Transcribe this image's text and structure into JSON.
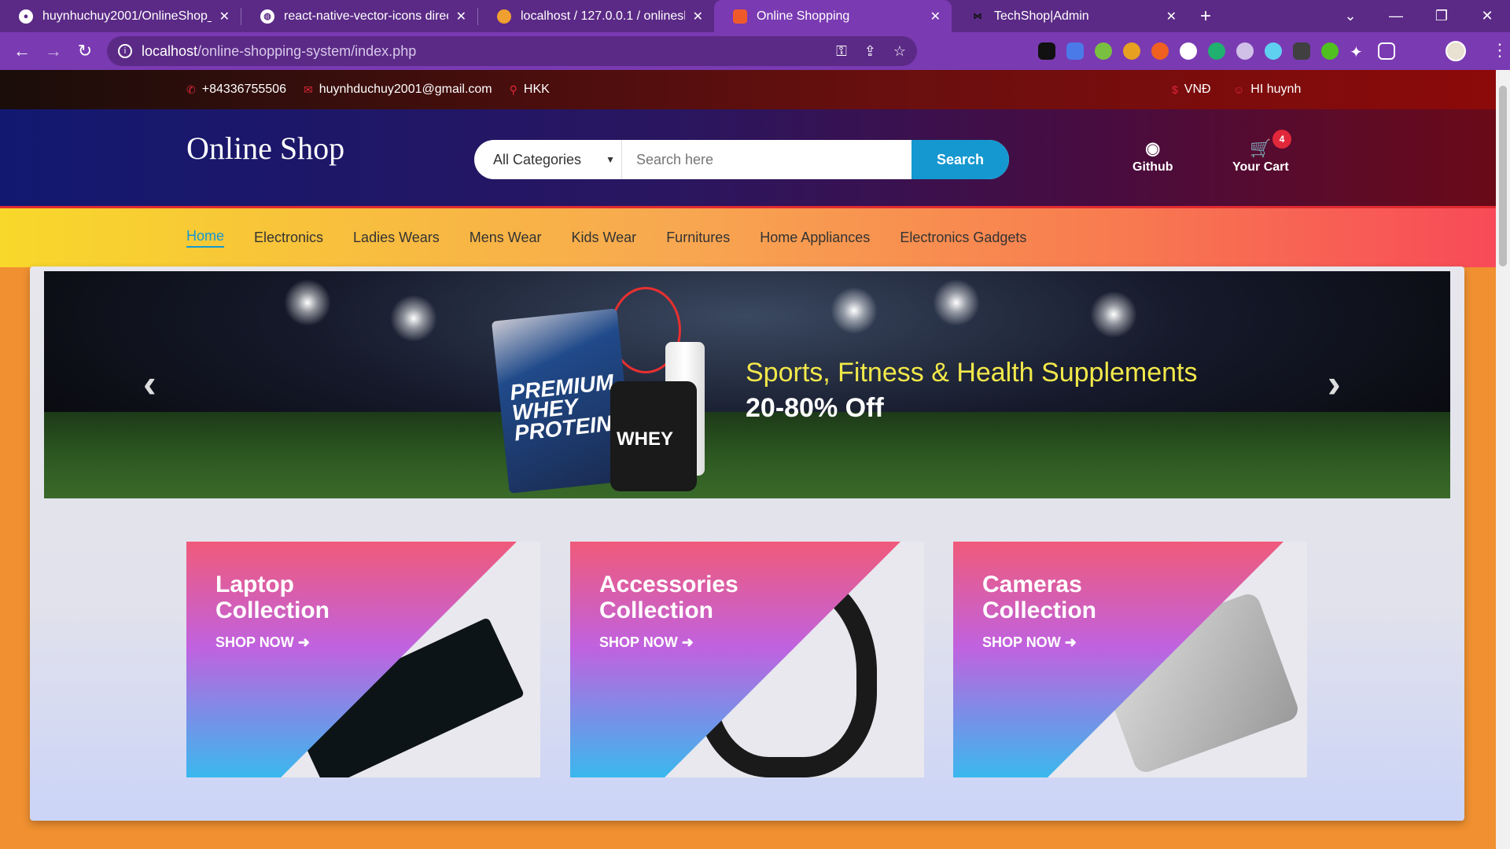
{
  "browser": {
    "tabs": [
      {
        "label": "huynhuchuy2001/OnlineShop_P..."
      },
      {
        "label": "react-native-vector-icons directo..."
      },
      {
        "label": "localhost / 127.0.0.1 / onlineshop..."
      },
      {
        "label": "Online Shopping"
      },
      {
        "label": "TechShop|Admin"
      }
    ],
    "url_host": "localhost",
    "url_path": "/online-shopping-system/index.php"
  },
  "topbar": {
    "phone": "+84336755506",
    "email": "huynhduchuy2001@gmail.com",
    "location": "HKK",
    "currency": "VNĐ",
    "user": "HI huynh"
  },
  "header": {
    "logo": "Online Shop",
    "category": "All Categories",
    "search_placeholder": "Search here",
    "search_button": "Search",
    "github_label": "Github",
    "cart_label": "Your Cart",
    "cart_count": "4"
  },
  "menu": [
    "Home",
    "Electronics",
    "Ladies Wears",
    "Mens Wear",
    "Kids Wear",
    "Furnitures",
    "Home Appliances",
    "Electronics Gadgets"
  ],
  "banner": {
    "title": "Sports, Fitness & Health Supplements",
    "subtitle": "20-80% Off",
    "bag_text": "PREMIUM WHEY PROTEIN",
    "jar_text": "WHEY"
  },
  "promos": [
    {
      "line1": "Laptop",
      "line2": "Collection",
      "cta": "SHOP NOW"
    },
    {
      "line1": "Accessories",
      "line2": "Collection",
      "cta": "SHOP NOW"
    },
    {
      "line1": "Cameras",
      "line2": "Collection",
      "cta": "SHOP NOW"
    }
  ],
  "colors": {
    "brand_blue": "#1598d0",
    "accent_red": "#e0283a",
    "browser_purple": "#7a3ab2"
  }
}
